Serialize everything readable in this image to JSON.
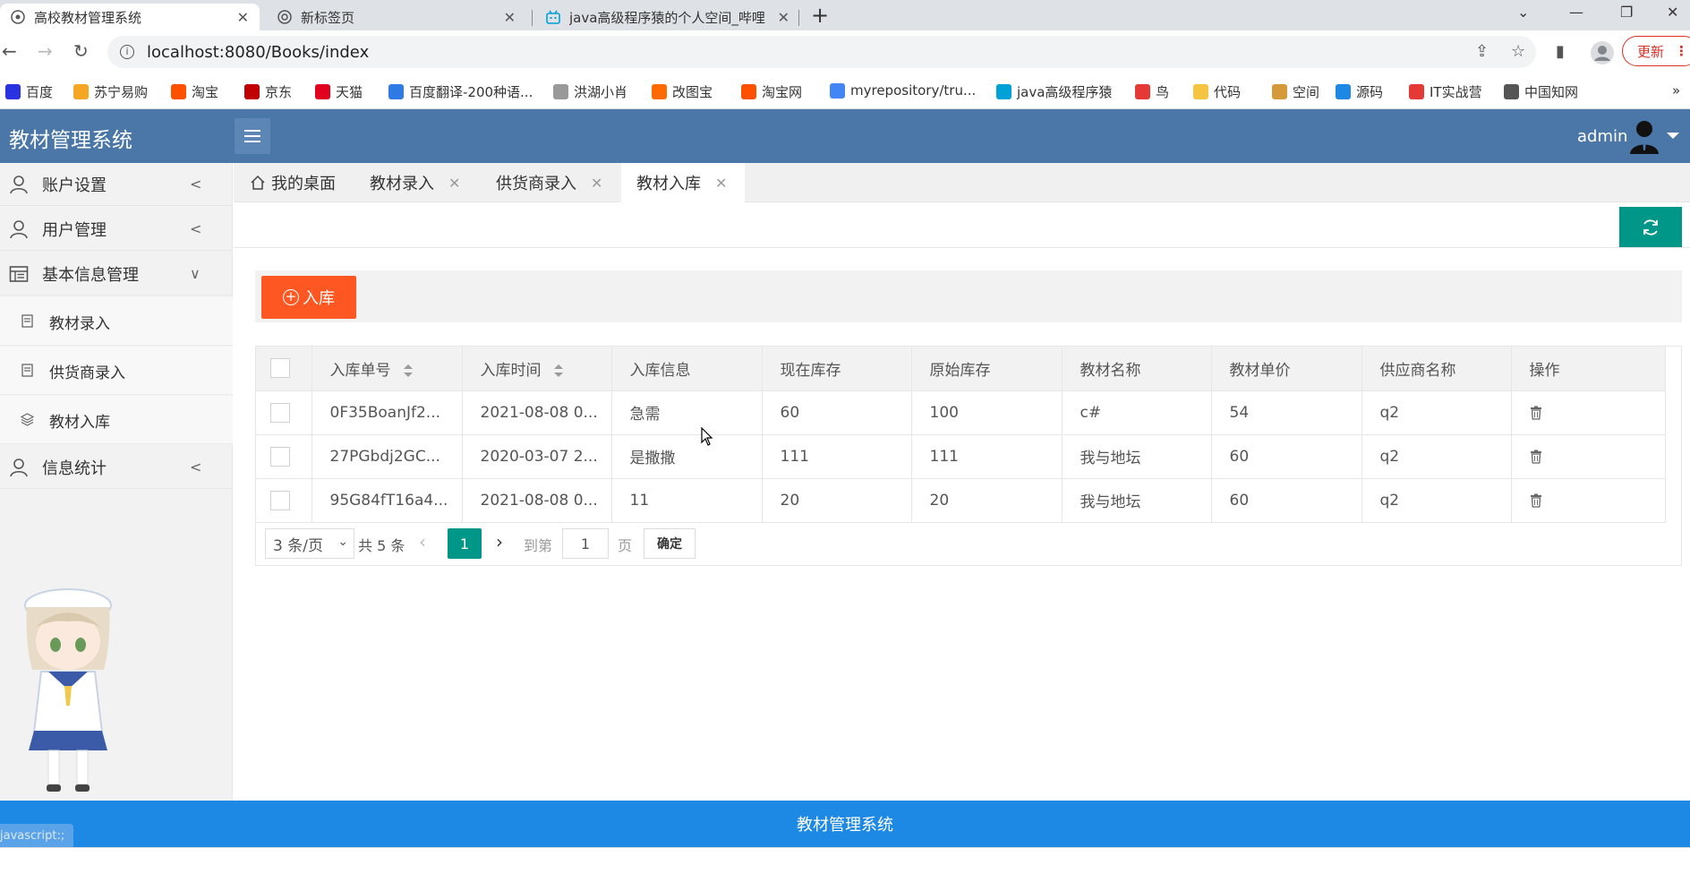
{
  "browser": {
    "tabs": [
      {
        "title": "高校教材管理系统",
        "icon": "page-icon"
      },
      {
        "title": "新标签页",
        "icon": "chrome-icon"
      },
      {
        "title": "java高级程序猿的个人空间_哔哩",
        "icon": "bilibili-icon"
      }
    ],
    "url": "localhost:8080/Books/index",
    "update_label": "更新",
    "bookmarks": [
      "百度",
      "苏宁易购",
      "淘宝",
      "京东",
      "天猫",
      "百度翻译-200种语...",
      "洪湖小肖",
      "改图宝",
      "淘宝网",
      "myrepository/tru...",
      "java高级程序猿",
      "鸟",
      "代码",
      "空间",
      "源码",
      "IT实战营",
      "中国知网"
    ],
    "bookmark_colors": [
      "#2932e1",
      "#f5a623",
      "#ff5000",
      "#c00000",
      "#e1001e",
      "#2f7be5",
      "#999999",
      "#ff6a00",
      "#ff5000",
      "#4285f4",
      "#00a1d6",
      "#e53935",
      "#f5c542",
      "#d49a3a",
      "#1e88e5",
      "#e53935",
      "#555555"
    ],
    "more_bookmarks": "»"
  },
  "app": {
    "title": "教材管理系统",
    "user": "admin",
    "header_color": "#4a77a8"
  },
  "sidebar": {
    "items": [
      {
        "label": "账户设置",
        "icon": "user-icon",
        "arrow": "<"
      },
      {
        "label": "用户管理",
        "icon": "user-icon",
        "arrow": "<"
      },
      {
        "label": "基本信息管理",
        "icon": "table-icon",
        "arrow": "∨"
      },
      {
        "label": "信息统计",
        "icon": "user-icon",
        "arrow": "<"
      }
    ],
    "subitems": [
      {
        "label": "教材录入",
        "icon": "book-icon"
      },
      {
        "label": "供货商录入",
        "icon": "book-icon"
      },
      {
        "label": "教材入库",
        "icon": "layers-icon"
      }
    ]
  },
  "pagetabs": [
    {
      "label": "我的桌面",
      "closable": false
    },
    {
      "label": "教材录入",
      "closable": true
    },
    {
      "label": "供货商录入",
      "closable": true
    },
    {
      "label": "教材入库",
      "closable": true
    }
  ],
  "toolbar": {
    "add_label": "入库"
  },
  "table": {
    "headers": [
      "入库单号",
      "入库时间",
      "入库信息",
      "现在库存",
      "原始库存",
      "教材名称",
      "教材单价",
      "供应商名称",
      "操作"
    ],
    "rows": [
      [
        "0F35BoanJf2...",
        "2021-08-08 0...",
        "急需",
        "60",
        "100",
        "c#",
        "54",
        "q2"
      ],
      [
        "27PGbdj2GC...",
        "2020-03-07 2...",
        "是撒撒",
        "111",
        "111",
        "我与地坛",
        "60",
        "q2"
      ],
      [
        "95G84fT16a4...",
        "2021-08-08 0...",
        "11",
        "20",
        "20",
        "我与地坛",
        "60",
        "q2"
      ]
    ]
  },
  "pager": {
    "page_size": "3 条/页",
    "total": "共 5 条",
    "current": "1",
    "goto_label": "到第",
    "goto_value": "1",
    "page_label": "页",
    "ok_label": "确定",
    "accent": "#009688"
  },
  "footer": {
    "text": "教材管理系统",
    "status_url": "javascript:;"
  }
}
